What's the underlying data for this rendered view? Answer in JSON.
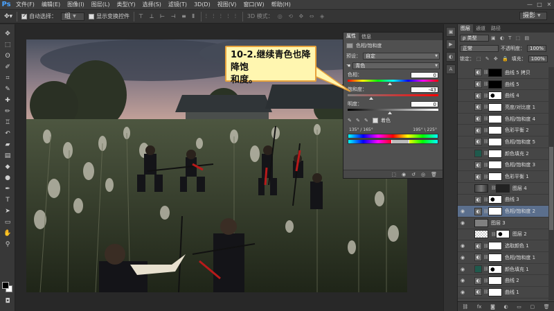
{
  "app": {
    "logo": "Ps"
  },
  "menubar": {
    "items": [
      "文件(F)",
      "编辑(E)",
      "图像(I)",
      "图层(L)",
      "类型(Y)",
      "选择(S)",
      "滤镜(T)",
      "3D(D)",
      "视图(V)",
      "窗口(W)",
      "帮助(H)"
    ],
    "window_controls": [
      "—",
      "□",
      "✕"
    ]
  },
  "options": {
    "auto_select_label": "自动选择：",
    "auto_select_value": "组",
    "show_transform_label": "显示变换控件",
    "mode3d_label": "3D 模式：",
    "workspace": "摄影"
  },
  "tools": [
    "move-tool",
    "marquee-tool",
    "lasso-tool",
    "quick-select-tool",
    "crop-tool",
    "eyedropper-tool",
    "healing-tool",
    "brush-tool",
    "stamp-tool",
    "history-brush-tool",
    "eraser-tool",
    "gradient-tool",
    "blur-tool",
    "dodge-tool",
    "pen-tool",
    "type-tool",
    "path-select-tool",
    "shape-tool",
    "hand-tool",
    "zoom-tool"
  ],
  "callout": {
    "line1": "10-2.继续青色也降降饱",
    "line2": "和度。"
  },
  "properties": {
    "tabs": [
      "属性",
      "信息"
    ],
    "title": "色相/饱和度",
    "preset_label": "预设：",
    "preset_value": "自定",
    "channel_value": "青色",
    "hue_label": "色相：",
    "hue_value": "0",
    "hue_pos": 0.5,
    "saturation_label": "饱和度：",
    "saturation_value": "-43",
    "saturation_pos": 0.285,
    "lightness_label": "明度：",
    "lightness_value": "0",
    "lightness_pos": 0.5,
    "colorize_label": "着色",
    "range_left": "135° / 165°",
    "range_right": "195° \\ 225°"
  },
  "layers_panel": {
    "tabs": [
      "图层",
      "通道",
      "路径"
    ],
    "filter_kind": "ρ 类型",
    "blend_mode": "正常",
    "opacity_label": "不透明度：",
    "opacity_value": "100%",
    "lock_label": "锁定：",
    "fill_label": "填充：",
    "fill_value": "100%",
    "items": [
      {
        "name": "曲线 5 拷贝",
        "type": "adj",
        "visible": false,
        "mask": "black",
        "indent": true
      },
      {
        "name": "曲线 5",
        "type": "adj",
        "visible": false,
        "mask": "black",
        "indent": true
      },
      {
        "name": "曲线 4",
        "type": "adj",
        "visible": false,
        "mask": "spots",
        "indent": true
      },
      {
        "name": "亮度/对比度 1",
        "type": "adj",
        "visible": false,
        "mask": "white",
        "indent": true
      },
      {
        "name": "色相/饱和度 4",
        "type": "adj",
        "visible": false,
        "mask": "white",
        "indent": true
      },
      {
        "name": "色彩平衡 2",
        "type": "adj",
        "visible": false,
        "mask": "white",
        "indent": true
      },
      {
        "name": "色相/饱和度 5",
        "type": "adj",
        "visible": false,
        "mask": "white",
        "indent": true
      },
      {
        "name": "颜色填充 2",
        "type": "fill",
        "visible": false,
        "mask": "white",
        "indent": true
      },
      {
        "name": "色相/饱和度 3",
        "type": "adj",
        "visible": false,
        "mask": "white",
        "indent": true
      },
      {
        "name": "色彩平衡 1",
        "type": "adj",
        "visible": false,
        "mask": "white",
        "indent": true
      },
      {
        "name": "图层 4",
        "type": "pixel",
        "visible": false,
        "mask": "photo",
        "indent": true
      },
      {
        "name": "曲线 3",
        "type": "adj",
        "visible": false,
        "mask": "spots",
        "indent": true
      },
      {
        "name": "色相/饱和度 2",
        "type": "adj",
        "visible": true,
        "mask": "white",
        "indent": true,
        "selected": true
      },
      {
        "name": "图层 3",
        "type": "gray",
        "visible": true,
        "mask": "none",
        "indent": true
      },
      {
        "name": "图层 2",
        "type": "checker",
        "visible": false,
        "mask": "spots",
        "indent": true
      },
      {
        "name": "选取颜色 1",
        "type": "adj",
        "visible": true,
        "mask": "white",
        "indent": true
      },
      {
        "name": "色相/饱和度 1",
        "type": "adj",
        "visible": true,
        "mask": "white",
        "indent": true
      },
      {
        "name": "颜色填充 1",
        "type": "fill",
        "visible": true,
        "mask": "spots",
        "indent": true
      },
      {
        "name": "曲线 2",
        "type": "adj",
        "visible": true,
        "mask": "white",
        "indent": true
      },
      {
        "name": "曲线 1",
        "type": "adj",
        "visible": true,
        "mask": "white",
        "indent": true
      }
    ]
  }
}
